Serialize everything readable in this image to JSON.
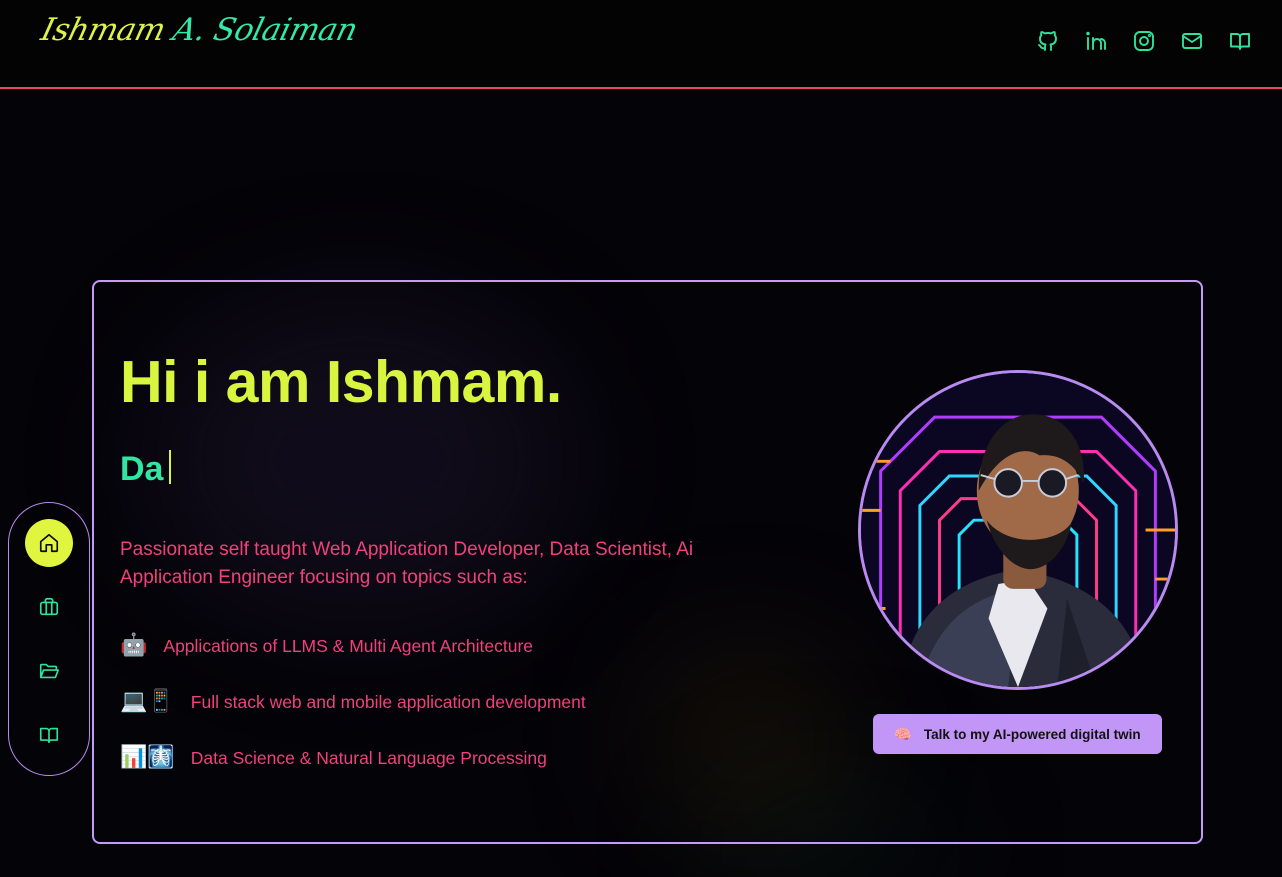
{
  "header": {
    "logo_part1": "Ishmam",
    "logo_part2": "A. Solaiman",
    "social": [
      {
        "icon": "github-icon"
      },
      {
        "icon": "linkedin-icon"
      },
      {
        "icon": "instagram-icon"
      },
      {
        "icon": "mail-icon"
      },
      {
        "icon": "book-open-icon"
      }
    ]
  },
  "hero": {
    "greeting": "Hi i am Ishmam.",
    "typed_text": "Da",
    "intro": "Passionate self taught Web Application Developer, Data Scientist, Ai Application Engineer focusing on topics such as:",
    "topics": [
      {
        "emoji": "🤖",
        "label": "Applications of LLMS & Multi Agent Architecture"
      },
      {
        "emoji": "💻📱",
        "label": "Full stack web and mobile application development"
      },
      {
        "emoji": "📊🩻",
        "label": "Data Science & Natural Language Processing"
      }
    ],
    "cta_icon": "🧠",
    "cta_label": "Talk to my AI-powered digital twin"
  },
  "sidenav": [
    {
      "icon": "home-icon",
      "active": true
    },
    {
      "icon": "briefcase-icon",
      "active": false
    },
    {
      "icon": "folder-open-icon",
      "active": false
    },
    {
      "icon": "book-open-icon",
      "active": false
    }
  ],
  "colors": {
    "accent_yellow": "#d8f53f",
    "accent_green": "#32e5a0",
    "accent_pink": "#f0417a",
    "accent_purple": "#c196f6",
    "header_border": "#e8465f",
    "background": "#040308"
  }
}
